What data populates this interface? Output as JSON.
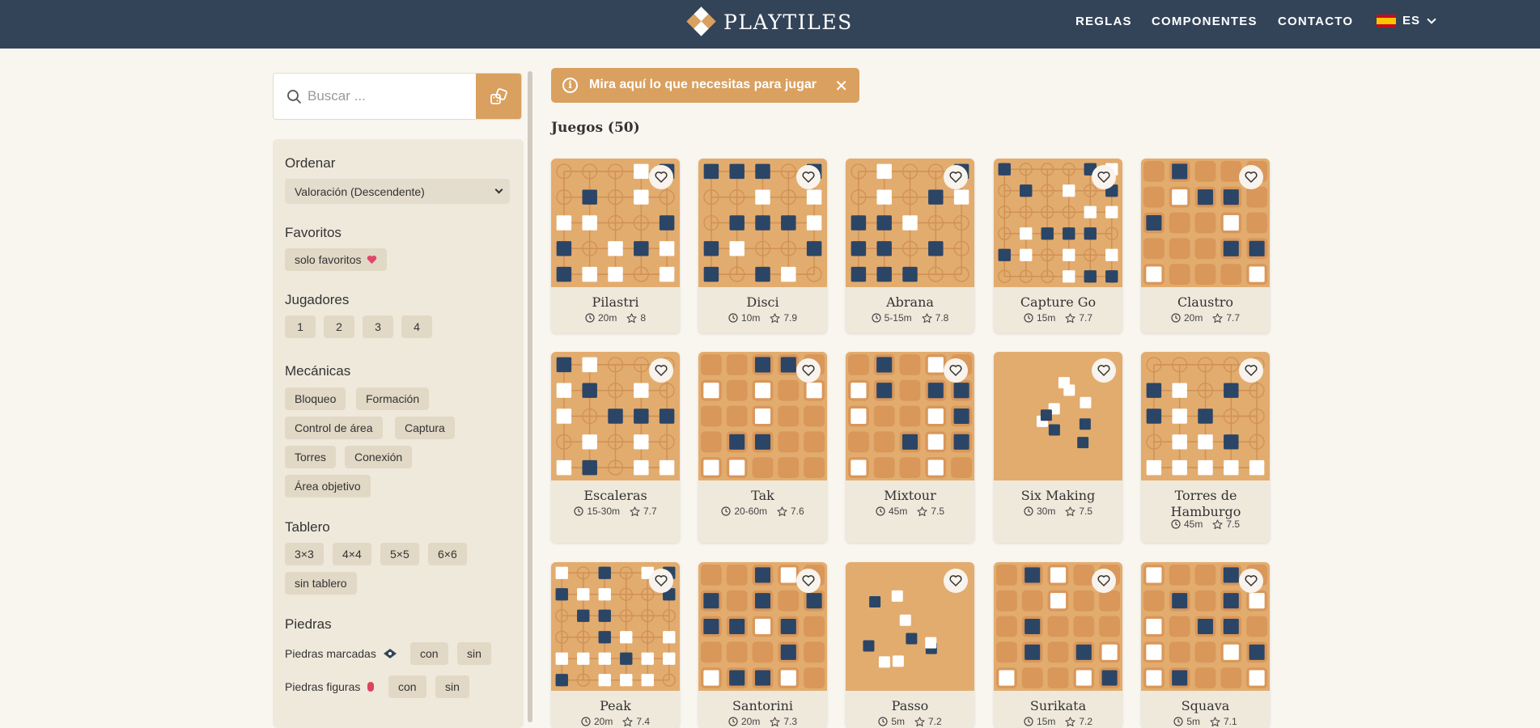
{
  "header": {
    "brand": "PLAYTILES",
    "nav": [
      "REGLAS",
      "COMPONENTES",
      "CONTACTO"
    ],
    "language": "ES",
    "colors": {
      "bar": "#334459",
      "accent": "#d9a05f"
    }
  },
  "search": {
    "placeholder": "Buscar ..."
  },
  "filters": {
    "sort": {
      "title": "Ordenar",
      "selected": "Valoración (Descendente)"
    },
    "favorites": {
      "title": "Favoritos",
      "chip": "solo favoritos"
    },
    "players": {
      "title": "Jugadores",
      "options": [
        "1",
        "2",
        "3",
        "4"
      ]
    },
    "mechanics": {
      "title": "Mecánicas",
      "options": [
        "Bloqueo",
        "Formación",
        "Control de área",
        "Captura",
        "Torres",
        "Conexión",
        "Área objetivo"
      ]
    },
    "board": {
      "title": "Tablero",
      "options": [
        "3×3",
        "4×4",
        "5×5",
        "6×6",
        "sin tablero"
      ]
    },
    "stones": {
      "title": "Piedras",
      "marked": {
        "label": "Piedras marcadas",
        "options": [
          "con",
          "sin"
        ]
      },
      "figures": {
        "label": "Piedras figuras",
        "options": [
          "con",
          "sin"
        ]
      }
    }
  },
  "notice": {
    "text": "Mira aquí lo que necesitas para jugar"
  },
  "games_heading": "Juegos (50)",
  "games": [
    {
      "name": "Pilastri",
      "time": "20m",
      "rating": "8",
      "style": "grid5"
    },
    {
      "name": "Disci",
      "time": "10m",
      "rating": "7.9",
      "style": "grid5"
    },
    {
      "name": "Abrana",
      "time": "5-15m",
      "rating": "7.8",
      "style": "grid5"
    },
    {
      "name": "Capture Go",
      "time": "15m",
      "rating": "7.7",
      "style": "grid6"
    },
    {
      "name": "Claustro",
      "time": "20m",
      "rating": "7.7",
      "style": "squares5"
    },
    {
      "name": "Escaleras",
      "time": "15-30m",
      "rating": "7.7",
      "style": "grid5"
    },
    {
      "name": "Tak",
      "time": "20-60m",
      "rating": "7.6",
      "style": "squares5"
    },
    {
      "name": "Mixtour",
      "time": "45m",
      "rating": "7.5",
      "style": "squares5"
    },
    {
      "name": "Six Making",
      "time": "30m",
      "rating": "7.5",
      "style": "plain"
    },
    {
      "name": "Torres de Hamburgo",
      "time": "45m",
      "rating": "7.5",
      "style": "grid5"
    },
    {
      "name": "Peak",
      "time": "20m",
      "rating": "7.4",
      "style": "grid6"
    },
    {
      "name": "Santorini",
      "time": "20m",
      "rating": "7.3",
      "style": "squares5"
    },
    {
      "name": "Passo",
      "time": "5m",
      "rating": "7.2",
      "style": "plain"
    },
    {
      "name": "Surikata",
      "time": "15m",
      "rating": "7.2",
      "style": "squares5"
    },
    {
      "name": "Squava",
      "time": "5m",
      "rating": "7.1",
      "style": "squares5"
    }
  ]
}
